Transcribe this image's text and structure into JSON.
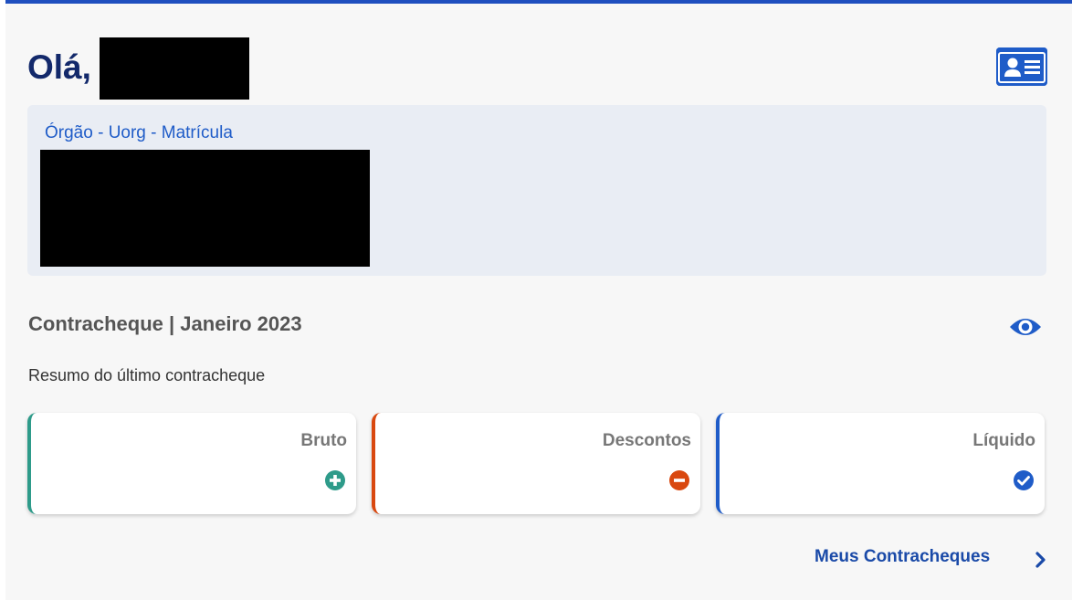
{
  "greeting": "Olá,",
  "info": {
    "label": "Órgão - Uorg - Matrícula"
  },
  "payslip": {
    "title": "Contracheque | Janeiro 2023",
    "subtitle": "Resumo do último contracheque",
    "cards": [
      {
        "label": "Bruto",
        "value": "",
        "icon": "plus-circle-icon",
        "color": "#2e9b8a"
      },
      {
        "label": "Descontos",
        "value": "",
        "icon": "minus-circle-icon",
        "color": "#d9480f"
      },
      {
        "label": "Líquido",
        "value": "",
        "icon": "check-circle-icon",
        "color": "#1f5cc8"
      }
    ]
  },
  "link": {
    "label": "Meus Contracheques"
  },
  "colors": {
    "accent": "#1f4fbf",
    "heading": "#13296b",
    "info_bg": "#e9edf4"
  }
}
